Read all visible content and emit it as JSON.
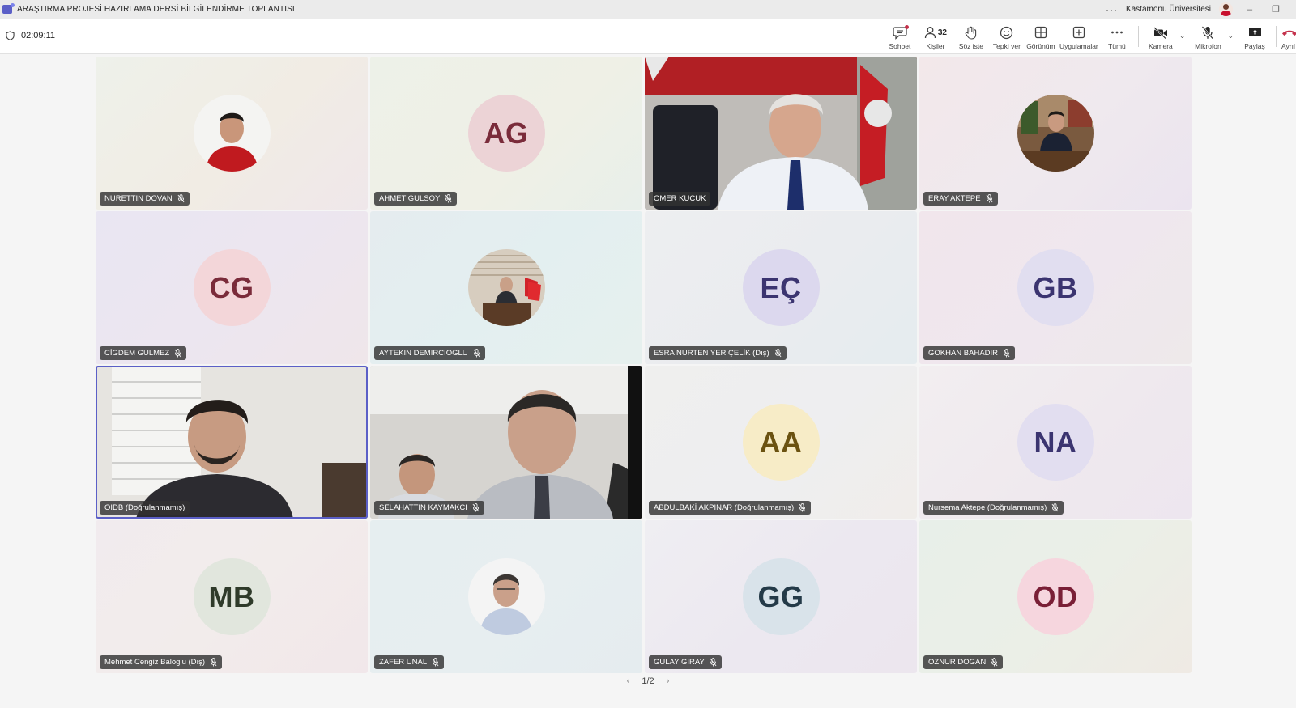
{
  "window": {
    "title": "ARAŞTIRMA PROJESİ HAZIRLAMA DERSİ BİLGİLENDİRME TOPLANTISI",
    "more_icon": "more-horizontal-icon",
    "org": "Kastamonu Üniversitesi",
    "minimize": "–",
    "restore": "❐"
  },
  "toolbar": {
    "timer": "02:09:11",
    "chat_label": "Sohbet",
    "people_label": "Kişiler",
    "people_count": "32",
    "raise_hand_label": "Söz iste",
    "react_label": "Tepki ver",
    "view_label": "Görünüm",
    "apps_label": "Uygulamalar",
    "more_label": "Tümü",
    "camera_label": "Kamera",
    "mic_label": "Mikrofon",
    "share_label": "Paylaş",
    "leave_label": "Ayrıl",
    "leave_color": "#c4314b",
    "accent": "#5b5fc7"
  },
  "participants": [
    {
      "name": "NURETTIN DOVAN",
      "kind": "photo",
      "muted": true
    },
    {
      "name": "AHMET GULSOY",
      "kind": "initials",
      "initials": "AG",
      "bg": "#ecd3d6",
      "fg": "#7a2b3a",
      "muted": true
    },
    {
      "name": "OMER KUCUK",
      "kind": "video",
      "muted": false
    },
    {
      "name": "ERAY AKTEPE",
      "kind": "photo",
      "muted": true
    },
    {
      "name": "CİGDEM GULMEZ",
      "kind": "initials",
      "initials": "CG",
      "bg": "#f3d6d9",
      "fg": "#7a2b3a",
      "muted": true
    },
    {
      "name": "AYTEKIN DEMIRCIOGLU",
      "kind": "photo",
      "muted": true
    },
    {
      "name": "ESRA NURTEN YER ÇELİK (Dış)",
      "kind": "initials",
      "initials": "EÇ",
      "bg": "#dcd8ee",
      "fg": "#3b3470",
      "muted": true
    },
    {
      "name": "GOKHAN BAHADIR",
      "kind": "initials",
      "initials": "GB",
      "bg": "#e1def0",
      "fg": "#3b3470",
      "muted": true
    },
    {
      "name": "OIDB (Doğrulanmamış)",
      "kind": "video",
      "muted": false
    },
    {
      "name": "SELAHATTIN KAYMAKCI",
      "kind": "video",
      "muted": true
    },
    {
      "name": "ABDULBAKİ AKPINAR (Doğrulanmamış)",
      "kind": "initials",
      "initials": "AA",
      "bg": "#f7ecc7",
      "fg": "#6b5211",
      "muted": true
    },
    {
      "name": "Nursema Aktepe (Doğrulanmamış)",
      "kind": "initials",
      "initials": "NA",
      "bg": "#e2def0",
      "fg": "#3b3470",
      "muted": true
    },
    {
      "name": "Mehmet Cengiz Baloglu (Dış)",
      "kind": "initials",
      "initials": "MB",
      "bg": "#e1e6dd",
      "fg": "#2f3b2a",
      "muted": true
    },
    {
      "name": "ZAFER UNAL",
      "kind": "photo",
      "muted": true
    },
    {
      "name": "GULAY GIRAY",
      "kind": "initials",
      "initials": "GG",
      "bg": "#d9e3ea",
      "fg": "#243a48",
      "muted": true
    },
    {
      "name": "OZNUR DOGAN",
      "kind": "initials",
      "initials": "OD",
      "bg": "#f6d6de",
      "fg": "#7a1f36",
      "muted": true
    }
  ],
  "pager": {
    "prev": "‹",
    "label": "1/2",
    "next": "›"
  }
}
